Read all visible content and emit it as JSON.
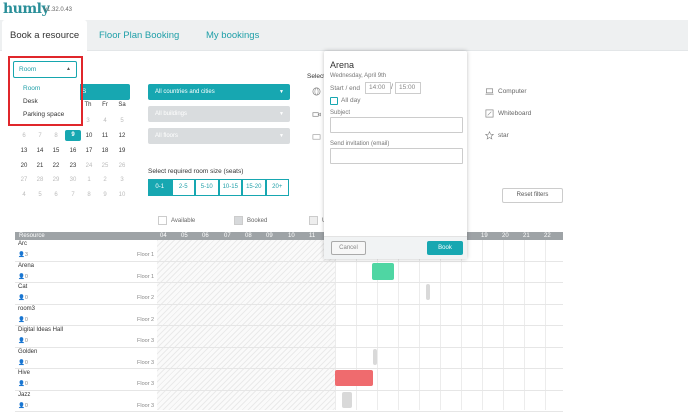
{
  "app": {
    "logo": "humly",
    "version": "v1.32.0.43"
  },
  "tabs": [
    "Book a resource",
    "Floor Plan Booking",
    "My bookings"
  ],
  "type_select": {
    "value": "Room",
    "options": [
      "Room",
      "Desk",
      "Parking space"
    ]
  },
  "calendar": {
    "strip_label": "S",
    "weekdays": [
      "Th",
      "Fr",
      "Sa"
    ],
    "rows": [
      [
        "",
        "",
        "",
        "3",
        "4",
        "5"
      ],
      [
        "6",
        "7",
        "8",
        "9",
        "10",
        "11",
        "12"
      ],
      [
        "13",
        "14",
        "15",
        "16",
        "17",
        "18",
        "19"
      ],
      [
        "20",
        "21",
        "22",
        "23",
        "24",
        "25",
        "26"
      ],
      [
        "27",
        "28",
        "29",
        "30",
        "1",
        "2",
        "3"
      ],
      [
        "4",
        "5",
        "6",
        "7",
        "8",
        "9",
        "10"
      ]
    ],
    "today": "9"
  },
  "filters": {
    "country": "All countries and cities",
    "building": "All buildings",
    "floor": "All floors",
    "select_label": "Select",
    "room_size_label": "Select required room size (seats)",
    "sizes": [
      "0-1",
      "2-5",
      "5-10",
      "10-15",
      "15-20",
      "20+"
    ],
    "active_size": "0-1"
  },
  "amenities": [
    "Computer",
    "Whiteboard",
    "star"
  ],
  "reset_label": "Reset filters",
  "legend": {
    "available": "Available",
    "booked": "Booked",
    "other": "U"
  },
  "grid": {
    "resource_header": "Resource",
    "hours": [
      "04",
      "05",
      "06",
      "07",
      "08",
      "09",
      "10",
      "11",
      "19",
      "20",
      "21",
      "22"
    ],
    "rows": [
      {
        "name": "Arc",
        "cap": "3",
        "floor": "Floor 1"
      },
      {
        "name": "Arena",
        "cap": "0",
        "floor": "Floor 1"
      },
      {
        "name": "Cat",
        "cap": "0",
        "floor": "Floor 2"
      },
      {
        "name": "room3",
        "cap": "0",
        "floor": "Floor 2"
      },
      {
        "name": "Digital Ideas Hall",
        "cap": "0",
        "floor": "Floor 3"
      },
      {
        "name": "Golden",
        "cap": "0",
        "floor": "Floor 3"
      },
      {
        "name": "Hive",
        "cap": "0",
        "floor": "Floor 3"
      },
      {
        "name": "Jazz",
        "cap": "0",
        "floor": "Floor 3"
      }
    ]
  },
  "modal": {
    "title": "Arena",
    "date": "Wednesday, April 9th",
    "start_end_label": "Start / end",
    "start": "14:00",
    "end": "15:00",
    "all_day": "All day",
    "subject_label": "Subject",
    "invite_label": "Send invitation (email)",
    "cancel": "Cancel",
    "book": "Book"
  },
  "colors": {
    "accent": "#17a7b1",
    "available": "#4fd6a3",
    "booked": "#ef6b6e"
  }
}
